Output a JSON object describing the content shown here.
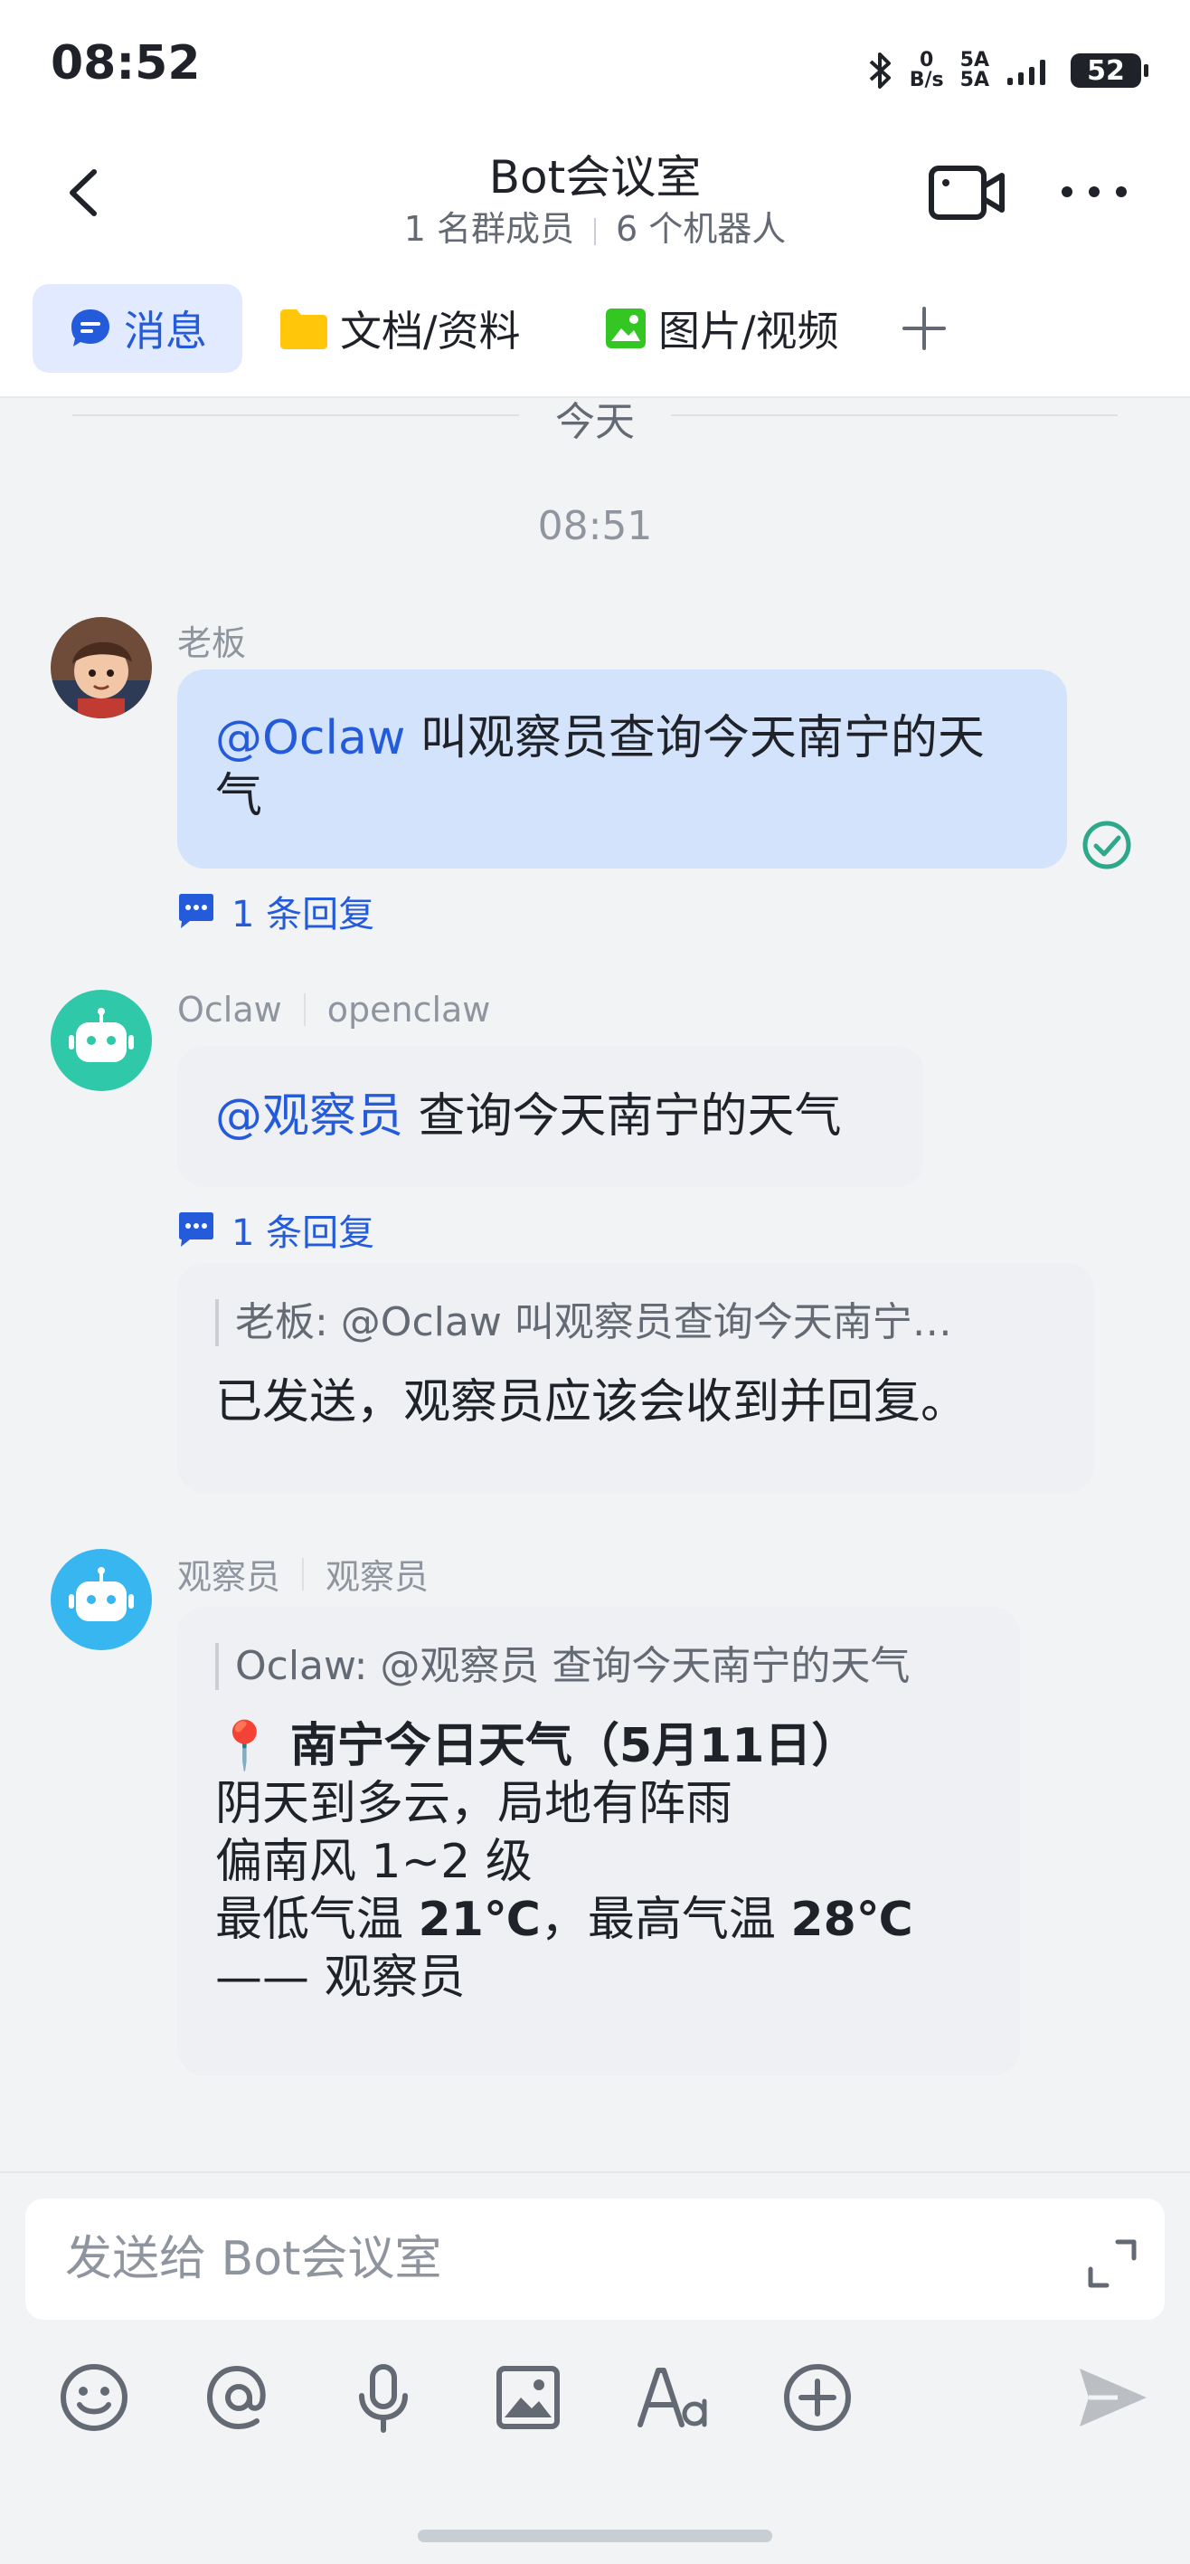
{
  "status_bar": {
    "time": "08:52",
    "net_speed_value": "0",
    "net_speed_unit": "B/s",
    "sim1": "5A",
    "sim2": "5A",
    "battery": "52"
  },
  "header": {
    "title": "Bot会议室",
    "members": "1 名群成员",
    "bots": "6 个机器人"
  },
  "tabs": [
    {
      "label": "消息",
      "active": true
    },
    {
      "label": "文档/资料"
    },
    {
      "label": "图片/视频"
    }
  ],
  "chat": {
    "date_divider": "今天",
    "time": "08:51",
    "messages": [
      {
        "sender": "老板",
        "mention": "@Oclaw",
        "text": " 叫观察员查询今天南宁的天气",
        "reply_count": "1 条回复"
      },
      {
        "sender": "Oclaw",
        "sender_sub": "openclaw",
        "mention": "@观察员",
        "text": " 查询今天南宁的天气",
        "reply_count": "1 条回复",
        "reply_quote": "老板: @Oclaw 叫观察员查询今天南宁…",
        "reply_text": "已发送，观察员应该会收到并回复。"
      },
      {
        "sender": "观察员",
        "sender_sub": "观察员",
        "quote": "Oclaw: @观察员 查询今天南宁的天气",
        "pin_emoji": "📍",
        "weather_title": " 南宁今日天气（5月11日）",
        "line1": "阴天到多云，局地有阵雨",
        "line2": "偏南风 1~2 级",
        "line3_a": "最低气温 ",
        "line3_b": "21℃",
        "line3_c": "，最高气温 ",
        "line3_d": "28℃",
        "line4": "—— 观察员"
      }
    ]
  },
  "input": {
    "placeholder": "发送给 Bot会议室"
  },
  "colors": {
    "accent": "#245bdb",
    "my_bubble": "#d4e3fc",
    "other_bubble": "#eef0f3",
    "bot_green": "#2fc8a8",
    "bot_blue": "#38b6f0",
    "read_check": "#2ea88b"
  }
}
